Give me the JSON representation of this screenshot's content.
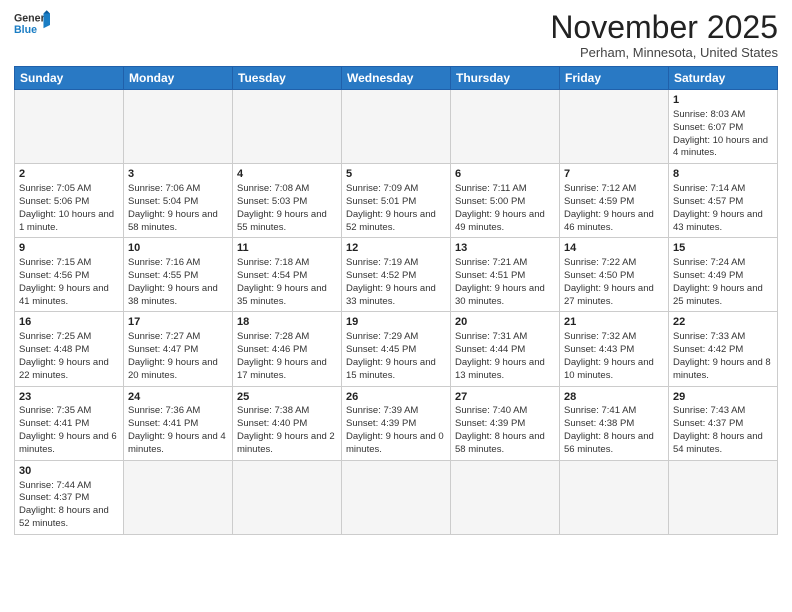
{
  "header": {
    "logo_general": "General",
    "logo_blue": "Blue",
    "month_title": "November 2025",
    "location": "Perham, Minnesota, United States"
  },
  "days_of_week": [
    "Sunday",
    "Monday",
    "Tuesday",
    "Wednesday",
    "Thursday",
    "Friday",
    "Saturday"
  ],
  "weeks": [
    [
      {
        "day": "",
        "info": ""
      },
      {
        "day": "",
        "info": ""
      },
      {
        "day": "",
        "info": ""
      },
      {
        "day": "",
        "info": ""
      },
      {
        "day": "",
        "info": ""
      },
      {
        "day": "",
        "info": ""
      },
      {
        "day": "1",
        "info": "Sunrise: 8:03 AM\nSunset: 6:07 PM\nDaylight: 10 hours\nand 4 minutes."
      }
    ],
    [
      {
        "day": "2",
        "info": "Sunrise: 7:05 AM\nSunset: 5:06 PM\nDaylight: 10 hours\nand 1 minute."
      },
      {
        "day": "3",
        "info": "Sunrise: 7:06 AM\nSunset: 5:04 PM\nDaylight: 9 hours\nand 58 minutes."
      },
      {
        "day": "4",
        "info": "Sunrise: 7:08 AM\nSunset: 5:03 PM\nDaylight: 9 hours\nand 55 minutes."
      },
      {
        "day": "5",
        "info": "Sunrise: 7:09 AM\nSunset: 5:01 PM\nDaylight: 9 hours\nand 52 minutes."
      },
      {
        "day": "6",
        "info": "Sunrise: 7:11 AM\nSunset: 5:00 PM\nDaylight: 9 hours\nand 49 minutes."
      },
      {
        "day": "7",
        "info": "Sunrise: 7:12 AM\nSunset: 4:59 PM\nDaylight: 9 hours\nand 46 minutes."
      },
      {
        "day": "8",
        "info": "Sunrise: 7:14 AM\nSunset: 4:57 PM\nDaylight: 9 hours\nand 43 minutes."
      }
    ],
    [
      {
        "day": "9",
        "info": "Sunrise: 7:15 AM\nSunset: 4:56 PM\nDaylight: 9 hours\nand 41 minutes."
      },
      {
        "day": "10",
        "info": "Sunrise: 7:16 AM\nSunset: 4:55 PM\nDaylight: 9 hours\nand 38 minutes."
      },
      {
        "day": "11",
        "info": "Sunrise: 7:18 AM\nSunset: 4:54 PM\nDaylight: 9 hours\nand 35 minutes."
      },
      {
        "day": "12",
        "info": "Sunrise: 7:19 AM\nSunset: 4:52 PM\nDaylight: 9 hours\nand 33 minutes."
      },
      {
        "day": "13",
        "info": "Sunrise: 7:21 AM\nSunset: 4:51 PM\nDaylight: 9 hours\nand 30 minutes."
      },
      {
        "day": "14",
        "info": "Sunrise: 7:22 AM\nSunset: 4:50 PM\nDaylight: 9 hours\nand 27 minutes."
      },
      {
        "day": "15",
        "info": "Sunrise: 7:24 AM\nSunset: 4:49 PM\nDaylight: 9 hours\nand 25 minutes."
      }
    ],
    [
      {
        "day": "16",
        "info": "Sunrise: 7:25 AM\nSunset: 4:48 PM\nDaylight: 9 hours\nand 22 minutes."
      },
      {
        "day": "17",
        "info": "Sunrise: 7:27 AM\nSunset: 4:47 PM\nDaylight: 9 hours\nand 20 minutes."
      },
      {
        "day": "18",
        "info": "Sunrise: 7:28 AM\nSunset: 4:46 PM\nDaylight: 9 hours\nand 17 minutes."
      },
      {
        "day": "19",
        "info": "Sunrise: 7:29 AM\nSunset: 4:45 PM\nDaylight: 9 hours\nand 15 minutes."
      },
      {
        "day": "20",
        "info": "Sunrise: 7:31 AM\nSunset: 4:44 PM\nDaylight: 9 hours\nand 13 minutes."
      },
      {
        "day": "21",
        "info": "Sunrise: 7:32 AM\nSunset: 4:43 PM\nDaylight: 9 hours\nand 10 minutes."
      },
      {
        "day": "22",
        "info": "Sunrise: 7:33 AM\nSunset: 4:42 PM\nDaylight: 9 hours\nand 8 minutes."
      }
    ],
    [
      {
        "day": "23",
        "info": "Sunrise: 7:35 AM\nSunset: 4:41 PM\nDaylight: 9 hours\nand 6 minutes."
      },
      {
        "day": "24",
        "info": "Sunrise: 7:36 AM\nSunset: 4:41 PM\nDaylight: 9 hours\nand 4 minutes."
      },
      {
        "day": "25",
        "info": "Sunrise: 7:38 AM\nSunset: 4:40 PM\nDaylight: 9 hours\nand 2 minutes."
      },
      {
        "day": "26",
        "info": "Sunrise: 7:39 AM\nSunset: 4:39 PM\nDaylight: 9 hours\nand 0 minutes."
      },
      {
        "day": "27",
        "info": "Sunrise: 7:40 AM\nSunset: 4:39 PM\nDaylight: 8 hours\nand 58 minutes."
      },
      {
        "day": "28",
        "info": "Sunrise: 7:41 AM\nSunset: 4:38 PM\nDaylight: 8 hours\nand 56 minutes."
      },
      {
        "day": "29",
        "info": "Sunrise: 7:43 AM\nSunset: 4:37 PM\nDaylight: 8 hours\nand 54 minutes."
      }
    ],
    [
      {
        "day": "30",
        "info": "Sunrise: 7:44 AM\nSunset: 4:37 PM\nDaylight: 8 hours\nand 52 minutes."
      },
      {
        "day": "",
        "info": ""
      },
      {
        "day": "",
        "info": ""
      },
      {
        "day": "",
        "info": ""
      },
      {
        "day": "",
        "info": ""
      },
      {
        "day": "",
        "info": ""
      },
      {
        "day": "",
        "info": ""
      }
    ]
  ]
}
